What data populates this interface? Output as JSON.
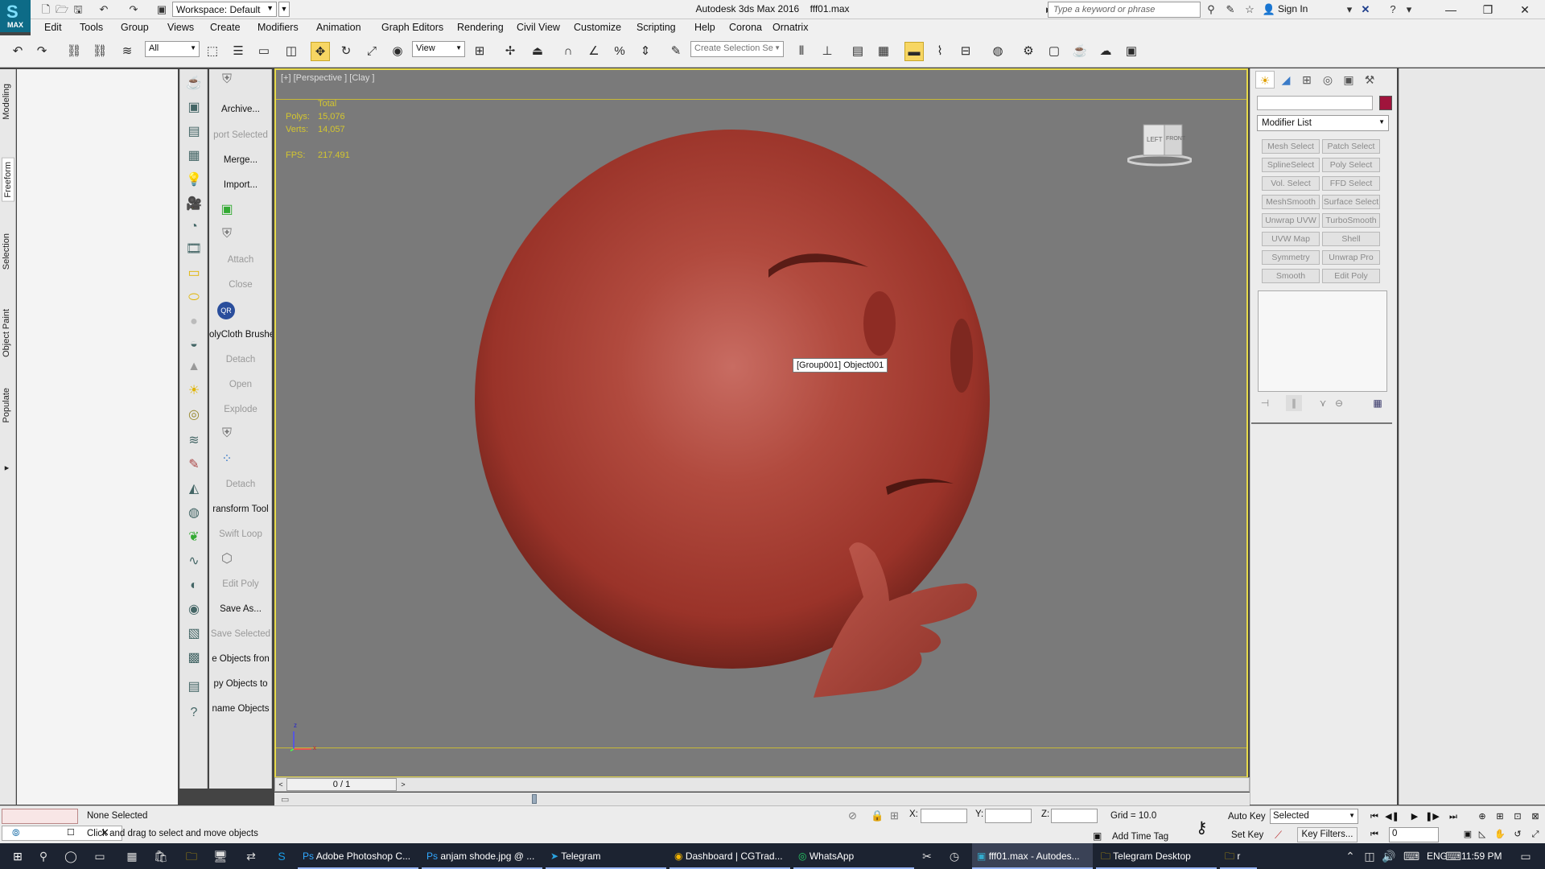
{
  "window": {
    "app_logo": "MAX",
    "title": "Autodesk 3ds Max 2016",
    "filename": "fff01.max",
    "workspace": "Workspace: Default"
  },
  "search": {
    "placeholder": "Type a keyword or phrase"
  },
  "account": {
    "signin": "Sign In"
  },
  "menu": [
    "Edit",
    "Tools",
    "Group",
    "Views",
    "Create",
    "Modifiers",
    "Animation",
    "Graph Editors",
    "Rendering",
    "Civil View",
    "Customize",
    "Scripting",
    "Help",
    "Corona",
    "Ornatrix"
  ],
  "toolbar": {
    "selection_filter": "All",
    "ref_coord": "View",
    "selection_set_placeholder": "Create Selection Se"
  },
  "ribbon_tabs": [
    "Modeling",
    "Freeform",
    "Selection",
    "Object Paint",
    "Populate"
  ],
  "ribbon_active": "Freeform",
  "command_labels": [
    {
      "label": "Archive...",
      "dim": false
    },
    {
      "label": "port Selected",
      "dim": true
    },
    {
      "label": "Merge...",
      "dim": false
    },
    {
      "label": "Import...",
      "dim": false
    },
    {
      "label": "Attach",
      "dim": true
    },
    {
      "label": "Close",
      "dim": true
    },
    {
      "label": "olyCloth Brushe",
      "dim": false
    },
    {
      "label": "Detach",
      "dim": true
    },
    {
      "label": "Open",
      "dim": true
    },
    {
      "label": "Explode",
      "dim": true
    },
    {
      "label": "Detach",
      "dim": true
    },
    {
      "label": "ransform Tool",
      "dim": false
    },
    {
      "label": "Swift Loop",
      "dim": true
    },
    {
      "label": "Edit Poly",
      "dim": true
    },
    {
      "label": "Save As...",
      "dim": false
    },
    {
      "label": "Save Selected",
      "dim": true
    },
    {
      "label": "e Objects fron",
      "dim": false
    },
    {
      "label": "py Objects to",
      "dim": false
    },
    {
      "label": "name Objects",
      "dim": false
    }
  ],
  "qr_badge": "QR",
  "viewport": {
    "label": "[+] [Perspective ] [Clay ]",
    "stats": {
      "header": "Total",
      "polys_label": "Polys:",
      "polys": "15,076",
      "verts_label": "Verts:",
      "verts": "14,057",
      "fps_label": "FPS:",
      "fps": "217.491"
    },
    "tooltip": "[Group001] Object001",
    "viewcube_left": "LEFT",
    "viewcube_front": "FRONT",
    "model_color": "#b4443a",
    "axis_x": "x",
    "axis_z": "z"
  },
  "timeline": {
    "frame": "0 / 1"
  },
  "command_panel": {
    "modifier_list": "Modifier List",
    "object_color": "#a0143c",
    "modifier_buttons": [
      "Mesh Select",
      "Patch Select",
      "SplineSelect",
      "Poly Select",
      "Vol. Select",
      "FFD Select",
      "MeshSmooth",
      "Surface Select",
      "Unwrap UVW",
      "TurboSmooth",
      "UVW Map",
      "Shell",
      "Symmetry",
      "Unwrap Pro",
      "Smooth",
      "Edit Poly"
    ]
  },
  "status": {
    "selection": "None Selected",
    "prompt": "Click and drag to select and move objects",
    "x_label": "X:",
    "y_label": "Y:",
    "z_label": "Z:",
    "grid": "Grid = 10.0",
    "add_time_tag": "Add Time Tag",
    "auto_key": "Auto Key",
    "set_key": "Set Key",
    "selected_dd": "Selected",
    "key_filters": "Key Filters...",
    "frame_value": "0"
  },
  "taskbar": {
    "items": [
      "Adobe Photoshop C...",
      "anjam shode.jpg @ ...",
      "Telegram",
      "Dashboard | CGTrad...",
      "WhatsApp",
      "fff01.max - Autodes...",
      "Telegram Desktop",
      "r"
    ],
    "language": "ENG",
    "time": "11:59 PM"
  }
}
